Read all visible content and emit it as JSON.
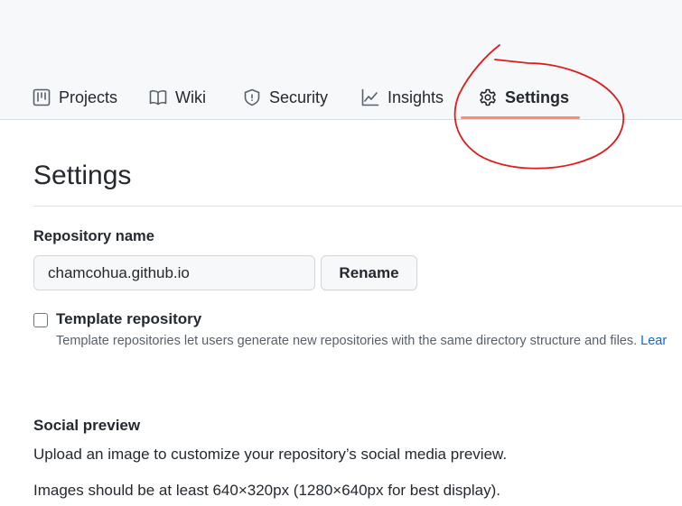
{
  "tabs": [
    {
      "label": "Projects",
      "icon": "project-board-icon"
    },
    {
      "label": "Wiki",
      "icon": "book-icon"
    },
    {
      "label": "Security",
      "icon": "shield-icon"
    },
    {
      "label": "Insights",
      "icon": "graph-icon"
    },
    {
      "label": "Settings",
      "icon": "gear-icon",
      "selected": true
    }
  ],
  "settings": {
    "title": "Settings",
    "repository_name_label": "Repository name",
    "repository_name_value": "chamcohua.github.io",
    "rename_label": "Rename",
    "template": {
      "label": "Template repository",
      "checked": false,
      "description": "Template repositories let users generate new repositories with the same directory structure and files.",
      "link_text": "Lear"
    },
    "social_preview": {
      "title": "Social preview",
      "line1": "Upload an image to customize your repository’s social media preview.",
      "line2": "Images should be at least 640×320px (1280×640px for best display)."
    }
  },
  "colors": {
    "selected_tab_underline": "#fd8c73",
    "annotation_stroke": "#e01b1b",
    "link": "#0969da"
  }
}
